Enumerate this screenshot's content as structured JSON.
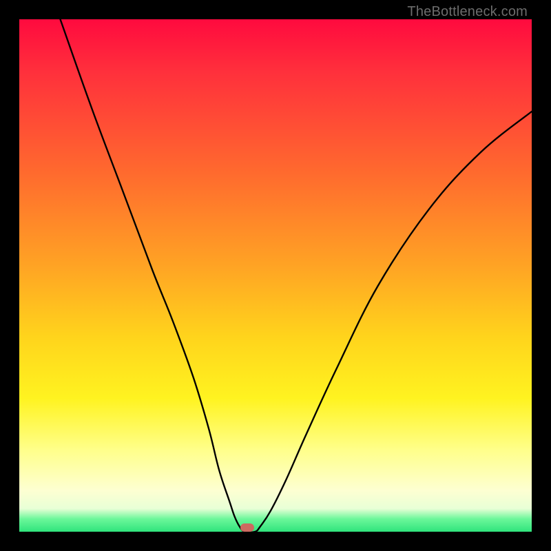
{
  "watermark": "TheBottleneck.com",
  "chart_data": {
    "type": "line",
    "title": "",
    "xlabel": "",
    "ylabel": "",
    "xlim": [
      0,
      100
    ],
    "ylim": [
      0,
      100
    ],
    "grid": false,
    "series": [
      {
        "name": "curve",
        "x": [
          8,
          14,
          20,
          26,
          30,
          34,
          37,
          39,
          41,
          42,
          43,
          44,
          46,
          47,
          49,
          52,
          56,
          62,
          70,
          80,
          90,
          100
        ],
        "values": [
          100,
          83,
          67,
          51,
          41,
          30,
          20,
          12,
          6,
          3,
          1,
          0,
          0,
          1,
          4,
          10,
          19,
          32,
          48,
          63,
          74,
          82
        ]
      }
    ],
    "marker": {
      "x": 44.5,
      "y": 0.8,
      "color": "#cd6a60"
    },
    "gradient_stops": [
      {
        "pos": 0,
        "color": "#ff0a3e"
      },
      {
        "pos": 0.1,
        "color": "#ff2f3c"
      },
      {
        "pos": 0.3,
        "color": "#ff6a2e"
      },
      {
        "pos": 0.48,
        "color": "#ffa324"
      },
      {
        "pos": 0.62,
        "color": "#ffd41c"
      },
      {
        "pos": 0.74,
        "color": "#fff320"
      },
      {
        "pos": 0.84,
        "color": "#ffff8a"
      },
      {
        "pos": 0.92,
        "color": "#fdffd2"
      },
      {
        "pos": 0.955,
        "color": "#e8ffd6"
      },
      {
        "pos": 0.975,
        "color": "#6cf79a"
      },
      {
        "pos": 1.0,
        "color": "#2fe47c"
      }
    ]
  }
}
